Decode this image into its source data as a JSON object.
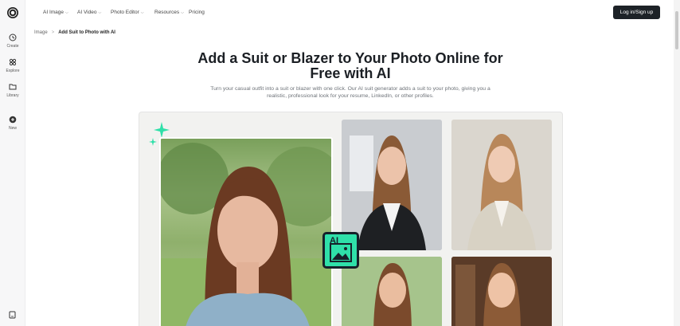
{
  "sidebar": {
    "items": [
      {
        "label": "Create",
        "icon": "create-icon"
      },
      {
        "label": "Explore",
        "icon": "explore-icon"
      },
      {
        "label": "Library",
        "icon": "library-icon"
      },
      {
        "label": "New",
        "icon": "new-icon"
      }
    ]
  },
  "nav": {
    "links": [
      {
        "label": "AI Image",
        "has_dropdown": true
      },
      {
        "label": "AI Video",
        "has_dropdown": true
      },
      {
        "label": "Photo Editor",
        "has_dropdown": true
      },
      {
        "label": "Resources",
        "has_dropdown": true
      },
      {
        "label": "Pricing",
        "has_dropdown": false
      }
    ],
    "login_label": "Log in/Sign up"
  },
  "breadcrumb": {
    "parent": "Image",
    "current": "Add Suit to Photo with AI"
  },
  "hero": {
    "title_line1": "Add a Suit or Blazer to Your Photo Online for",
    "title_line2": "Free with AI",
    "subtitle_line1": "Turn your casual outfit into a suit or blazer with one click. Our AI suit generator adds a suit to your photo, giving you a",
    "subtitle_line2": "realistic, professional look for your resume, LinkedIn, or other profiles."
  },
  "showcase": {
    "badge_text": "AI",
    "accent": "#2fe0a9",
    "images": [
      "main-portrait-photo",
      "suit-photo-1",
      "suit-photo-2",
      "suit-photo-3",
      "suit-photo-4"
    ]
  }
}
